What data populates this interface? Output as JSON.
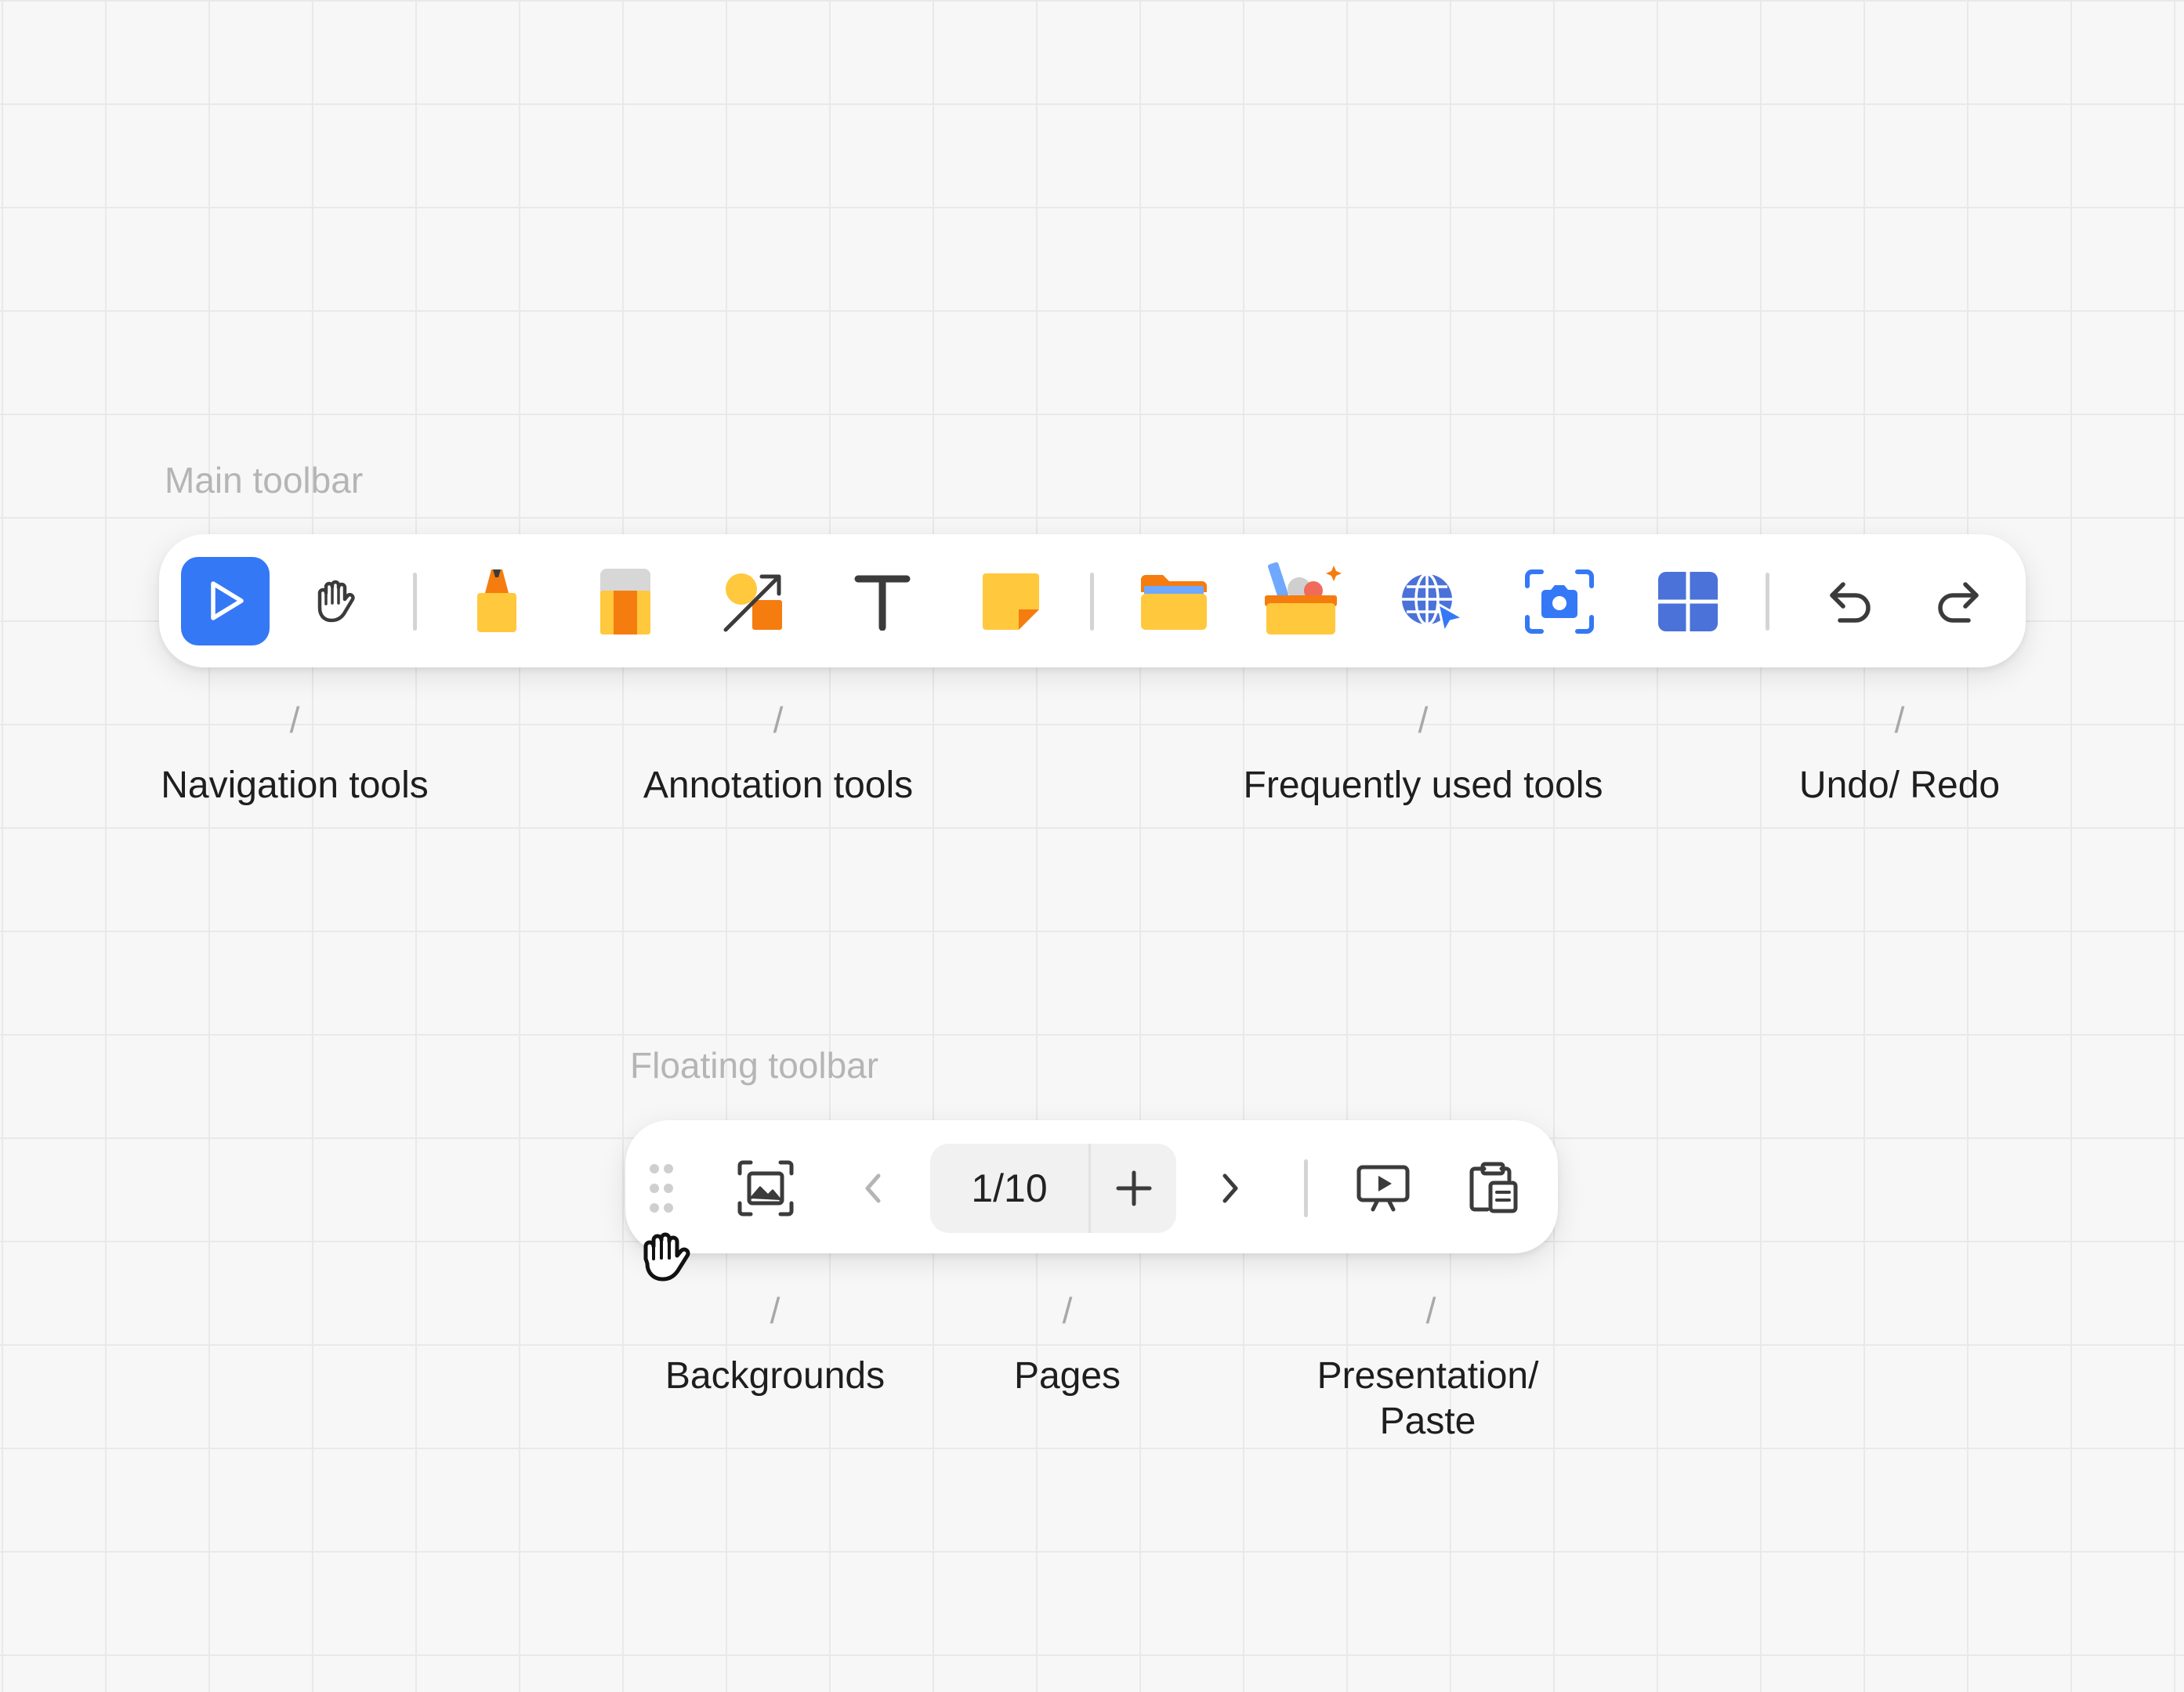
{
  "main_toolbar": {
    "section_label": "Main toolbar",
    "icons": {
      "select": "cursor-pointer-icon",
      "hand": "hand-pan-icon",
      "pen": "marker-pen-icon",
      "eraser": "eraser-icon",
      "shapes": "shapes-arrow-icon",
      "text": "text-tool-icon",
      "sticky": "sticky-note-icon",
      "folder": "folder-icon",
      "toolbox": "toolbox-icon",
      "browser": "globe-browser-icon",
      "screenshot": "camera-screenshot-icon",
      "apps": "apps-grid-icon",
      "undo": "undo-icon",
      "redo": "redo-icon"
    },
    "active_tool": "select"
  },
  "main_captions": {
    "navigation": "Navigation tools",
    "annotation": "Annotation tools",
    "frequent": "Frequently used tools",
    "undo_redo": "Undo/ Redo"
  },
  "floating_toolbar": {
    "section_label": "Floating toolbar",
    "page_counter": "1/10",
    "icons": {
      "drag": "drag-handle-icon",
      "grab_cursor": "grab-hand-cursor-icon",
      "background": "background-image-icon",
      "prev": "chevron-left-icon",
      "add_page": "plus-icon",
      "next": "chevron-right-icon",
      "present": "presentation-icon",
      "paste": "clipboard-paste-icon"
    }
  },
  "floating_captions": {
    "backgrounds": "Backgrounds",
    "pages": "Pages",
    "presentation_line1": "Presentation/",
    "presentation_line2": "Paste"
  },
  "slash_glyph": "/",
  "colors": {
    "accent_blue": "#3478f6",
    "yellow": "#ffc83d",
    "orange": "#f57c0f",
    "icon_dark": "#3b3b3b",
    "apps_blue": "#4a72d8"
  }
}
